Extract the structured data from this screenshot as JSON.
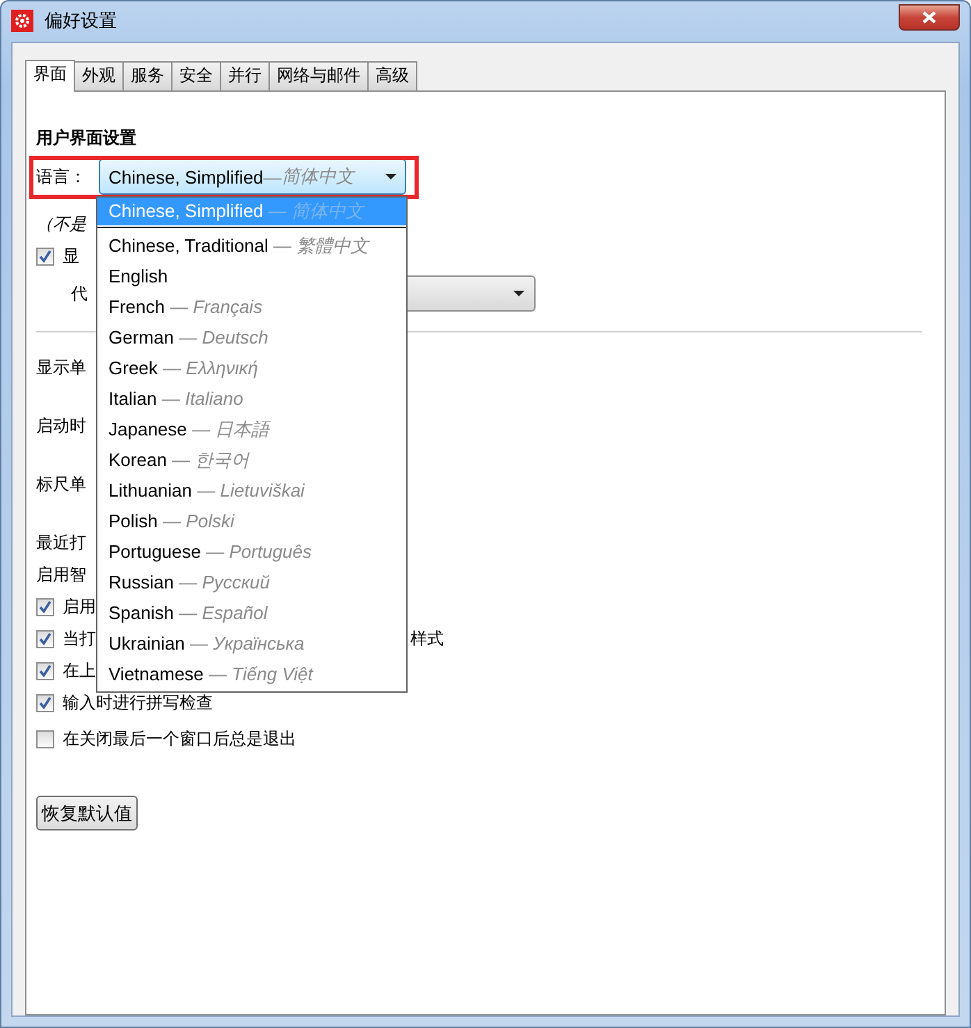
{
  "window": {
    "title": "偏好设置"
  },
  "tabs": [
    {
      "label": "界面",
      "selected": true
    },
    {
      "label": "外观",
      "selected": false
    },
    {
      "label": "服务",
      "selected": false
    },
    {
      "label": "安全",
      "selected": false
    },
    {
      "label": "并行",
      "selected": false
    },
    {
      "label": "网络与邮件",
      "selected": false
    },
    {
      "label": "高级",
      "selected": false
    }
  ],
  "section_title": "用户界面设置",
  "language": {
    "label": "语言：",
    "value": "Chinese, Simplified",
    "separator": "—",
    "native": "简体中文"
  },
  "rows": [
    {
      "kind": "note",
      "text": "（不是"
    },
    {
      "kind": "checkbox",
      "text": "显",
      "checked": true
    },
    {
      "kind": "combo",
      "text": "代"
    },
    {
      "kind": "rule"
    },
    {
      "kind": "field-label",
      "text": "显示单"
    },
    {
      "kind": "field-label",
      "text": "启动时"
    },
    {
      "kind": "field-label",
      "text": "标尺单"
    },
    {
      "kind": "label",
      "text": "最近打"
    },
    {
      "kind": "label",
      "text": "启用智"
    },
    {
      "kind": "checkbox",
      "text": "启用",
      "checked": true
    },
    {
      "kind": "checkbox",
      "text": "当打",
      "tail": "样式",
      "checked": true
    },
    {
      "kind": "checkbox",
      "text": "在上",
      "checked": true
    },
    {
      "kind": "checkbox",
      "text": "输入时进行拼写检查",
      "checked": true
    },
    {
      "kind": "checkbox",
      "text": "在关闭最后一个窗口后总是退出",
      "checked": false
    }
  ],
  "reset_button": "恢复默认值",
  "language_menu": [
    {
      "name": "Chinese, Simplified",
      "separator": "—",
      "native": "简体中文",
      "selected": true
    },
    {
      "name": "Chinese, Traditional",
      "separator": "—",
      "native": "繁體中文",
      "selected": false
    },
    {
      "name": "English",
      "selected": false
    },
    {
      "name": "French",
      "separator": "—",
      "native": "Français",
      "selected": false
    },
    {
      "name": "German",
      "separator": "—",
      "native": "Deutsch",
      "selected": false
    },
    {
      "name": "Greek",
      "separator": "—",
      "native": "Ελληνική",
      "selected": false
    },
    {
      "name": "Italian",
      "separator": "—",
      "native": "Italiano",
      "selected": false
    },
    {
      "name": "Japanese",
      "separator": "—",
      "native": "日本語",
      "selected": false
    },
    {
      "name": "Korean",
      "separator": "—",
      "native": "한국어",
      "selected": false
    },
    {
      "name": "Lithuanian",
      "separator": "—",
      "native": "Lietuviškai",
      "selected": false
    },
    {
      "name": "Polish",
      "separator": "—",
      "native": "Polski",
      "selected": false
    },
    {
      "name": "Portuguese",
      "separator": "—",
      "native": "Português",
      "selected": false
    },
    {
      "name": "Russian",
      "separator": "—",
      "native": "Русский",
      "selected": false
    },
    {
      "name": "Spanish",
      "separator": "—",
      "native": "Español",
      "selected": false
    },
    {
      "name": "Ukrainian",
      "separator": "—",
      "native": "Українська",
      "selected": false
    },
    {
      "name": "Vietnamese",
      "separator": "—",
      "native": "Tiếng Việt",
      "selected": false
    }
  ]
}
